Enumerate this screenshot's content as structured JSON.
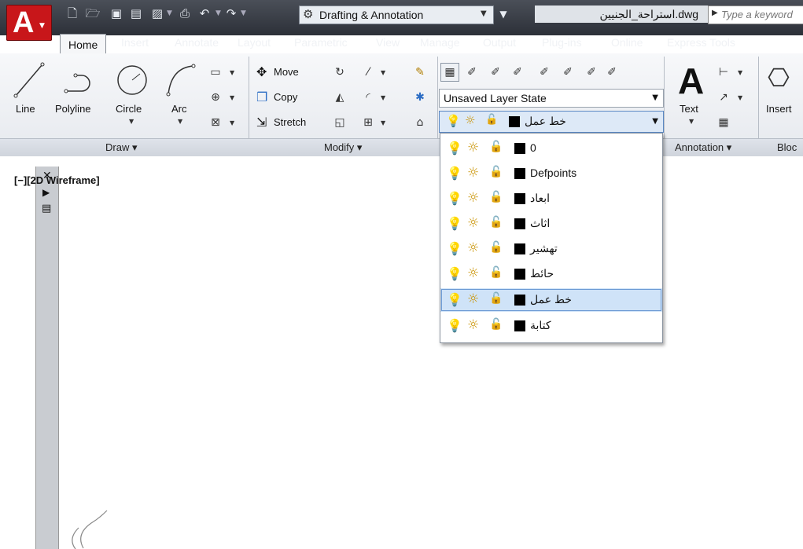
{
  "titlebar": {
    "workspace": "Drafting & Annotation",
    "filename": "استراحة_الجنيين.dwg",
    "search_placeholder": "Type a keyword"
  },
  "tabs": [
    "Home",
    "Insert",
    "Annotate",
    "Layout",
    "Parametric",
    "View",
    "Manage",
    "Output",
    "Plug-ins",
    "Online",
    "Express Tools"
  ],
  "ribbon": {
    "draw": {
      "line": "Line",
      "polyline": "Polyline",
      "circle": "Circle",
      "arc": "Arc",
      "title": "Draw ▾"
    },
    "modify": {
      "move": "Move",
      "copy": "Copy",
      "stretch": "Stretch",
      "title": "Modify ▾"
    },
    "layers": {
      "state_combo": "Unsaved Layer State",
      "current_layer": "خط عمل"
    },
    "annotation": {
      "text": "Text",
      "title": "Annotation ▾"
    },
    "block": {
      "insert": "Insert",
      "title": "Bloc"
    }
  },
  "layer_list": [
    {
      "name": "0"
    },
    {
      "name": "Defpoints"
    },
    {
      "name": "ابعاد"
    },
    {
      "name": "اثاث"
    },
    {
      "name": "تهشير"
    },
    {
      "name": "حائط"
    },
    {
      "name": "خط عمل",
      "selected": true
    },
    {
      "name": "كتابة"
    }
  ],
  "viewport": {
    "label": "[−][2D Wireframe]"
  },
  "colors": {
    "app_red": "#c8161a",
    "selection": "#cfe3f8",
    "titlebar": "#2c3038"
  }
}
